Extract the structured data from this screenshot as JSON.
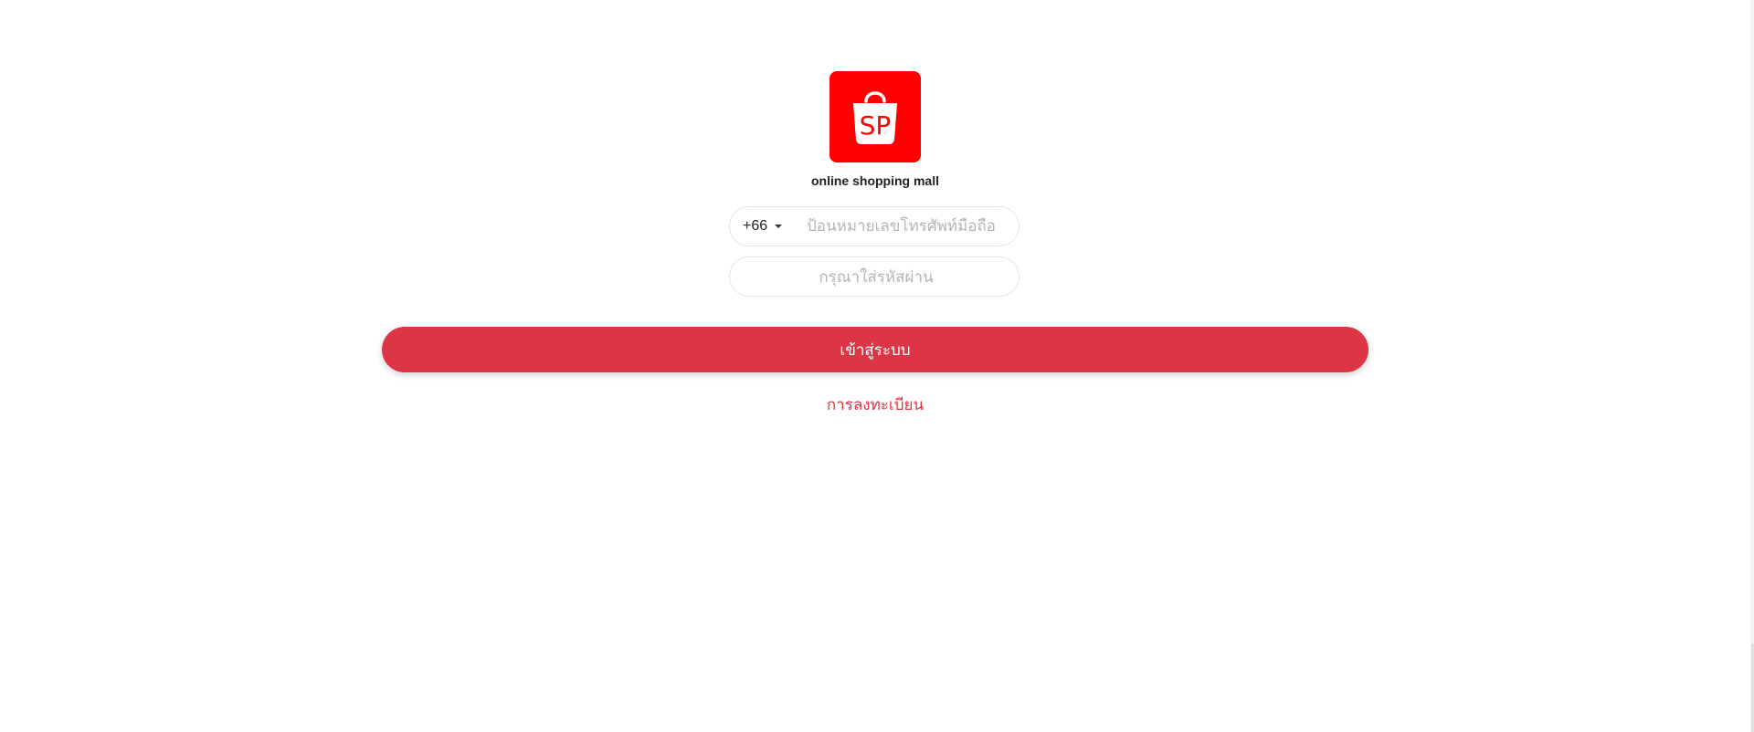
{
  "brand": {
    "logo_text": "SP",
    "logo_icon": "shopping-bag-icon",
    "tagline": "online shopping mall",
    "accent_color": "#ff0000"
  },
  "login_form": {
    "country_code": "+66",
    "phone_placeholder": "ป้อนหมายเลขโทรศัพท์มือถือ",
    "password_placeholder": "กรุณาใส่รหัสผ่าน",
    "login_label": "เข้าสู่ระบบ",
    "login_button_color": "#dc3545",
    "register_label": "การลงทะเบียน"
  }
}
